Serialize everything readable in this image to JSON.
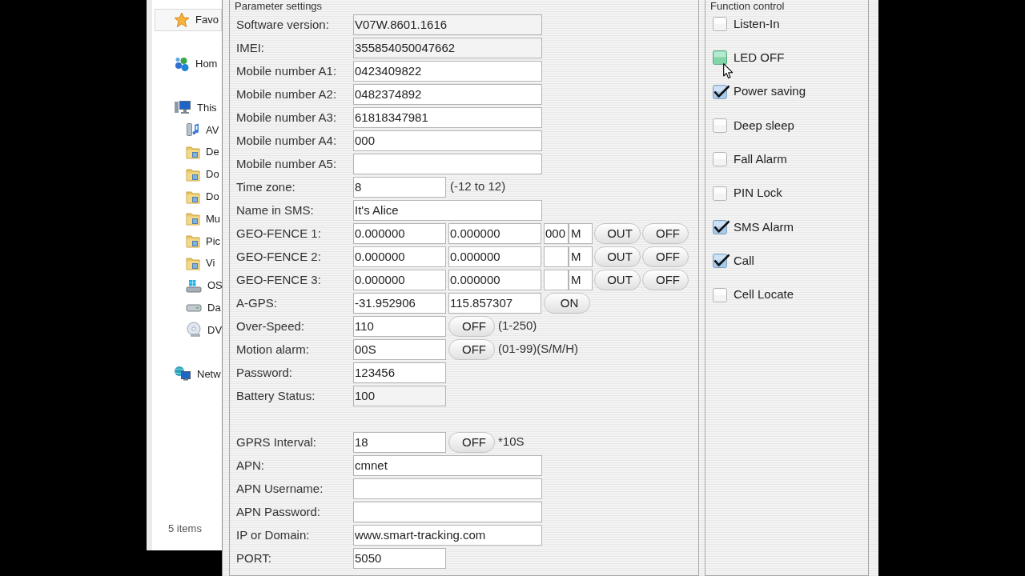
{
  "explorer": {
    "nav": [
      {
        "label": "Favo",
        "kind": "favorites",
        "selected": true
      },
      {
        "label": "Hom",
        "kind": "homegroup",
        "selected": false
      },
      {
        "label": "This",
        "kind": "computer",
        "selected": false,
        "children": [
          {
            "label": "AV",
            "kind": "device",
            "selected": false
          },
          {
            "label": "De",
            "kind": "folder",
            "selected": false
          },
          {
            "label": "Do",
            "kind": "folder",
            "selected": false
          },
          {
            "label": "Do",
            "kind": "folder",
            "selected": false
          },
          {
            "label": "Mu",
            "kind": "folder",
            "selected": false
          },
          {
            "label": "Pic",
            "kind": "folder",
            "selected": false
          },
          {
            "label": "Vi",
            "kind": "folder",
            "selected": false
          },
          {
            "label": "OS",
            "kind": "system_drive",
            "selected": false
          },
          {
            "label": "Da",
            "kind": "drive",
            "selected": false
          },
          {
            "label": "DV",
            "kind": "disc_drive",
            "selected": false
          }
        ]
      },
      {
        "label": "Netw",
        "kind": "network",
        "selected": false
      }
    ],
    "status": "5 items"
  },
  "parameters": {
    "title": "Parameter settings",
    "sections": [
      {
        "rows": [
          {
            "label": "Software version:",
            "parts": [
              {
                "kind": "long_field",
                "value": "V07W.8601.1616",
                "readonly": true
              }
            ]
          },
          {
            "label": "IMEI:",
            "parts": [
              {
                "kind": "long_field",
                "value": "355854050047662",
                "readonly": true
              }
            ]
          },
          {
            "label": "Mobile number A1:",
            "parts": [
              {
                "kind": "long_field",
                "value": "0423409822",
                "readonly": false
              }
            ]
          },
          {
            "label": "Mobile number A2:",
            "parts": [
              {
                "kind": "long_field",
                "value": "0482374892",
                "readonly": false
              }
            ]
          },
          {
            "label": "Mobile number A3:",
            "parts": [
              {
                "kind": "long_field",
                "value": "61818347981",
                "readonly": false
              }
            ]
          },
          {
            "label": "Mobile number A4:",
            "parts": [
              {
                "kind": "long_field",
                "value": "000",
                "readonly": false
              }
            ]
          },
          {
            "label": "Mobile number A5:",
            "parts": [
              {
                "kind": "long_field",
                "readonly": false
              }
            ]
          },
          {
            "label": "Time zone:",
            "parts": [
              {
                "kind": "short_field",
                "value": "8",
                "readonly": false
              },
              {
                "kind": "note",
                "text": "(-12 to 12)"
              }
            ]
          },
          {
            "label": "Name in SMS:",
            "parts": [
              {
                "kind": "long_field",
                "value": "It's Alice",
                "readonly": false
              }
            ]
          },
          {
            "label": "GEO-FENCE 1:",
            "parts": [
              {
                "kind": "short_field",
                "value": "0.000000",
                "readonly": false
              },
              {
                "kind": "short_field",
                "value": "0.000000",
                "readonly": false
              },
              {
                "kind": "tiny_field",
                "value": "000",
                "readonly": false
              },
              {
                "kind": "unit",
                "text": "M"
              },
              {
                "kind": "button",
                "text": "OUT"
              },
              {
                "kind": "button",
                "text": "OFF"
              }
            ]
          },
          {
            "label": "GEO-FENCE 2:",
            "parts": [
              {
                "kind": "short_field",
                "value": "0.000000",
                "readonly": false
              },
              {
                "kind": "short_field",
                "value": "0.000000",
                "readonly": false
              },
              {
                "kind": "tiny_field",
                "readonly": false
              },
              {
                "kind": "unit",
                "text": "M"
              },
              {
                "kind": "button",
                "text": "OUT"
              },
              {
                "kind": "button",
                "text": "OFF"
              }
            ]
          },
          {
            "label": "GEO-FENCE 3:",
            "parts": [
              {
                "kind": "short_field",
                "value": "0.000000",
                "readonly": false
              },
              {
                "kind": "short_field",
                "value": "0.000000",
                "readonly": false
              },
              {
                "kind": "tiny_field",
                "readonly": false
              },
              {
                "kind": "unit",
                "text": "M"
              },
              {
                "kind": "button",
                "text": "OUT"
              },
              {
                "kind": "button",
                "text": "OFF"
              }
            ]
          },
          {
            "label": "A-GPS:",
            "parts": [
              {
                "kind": "short_field",
                "value": "-31.952906",
                "readonly": false
              },
              {
                "kind": "short_field",
                "value": "115.857307",
                "readonly": false
              },
              {
                "kind": "button",
                "text": "ON"
              }
            ]
          },
          {
            "label": "Over-Speed:",
            "parts": [
              {
                "kind": "short_field",
                "value": "110",
                "readonly": false
              },
              {
                "kind": "button",
                "text": "OFF"
              },
              {
                "kind": "note",
                "text": "(1-250)"
              }
            ]
          },
          {
            "label": "Motion alarm:",
            "parts": [
              {
                "kind": "short_field",
                "value": "00S",
                "readonly": false
              },
              {
                "kind": "button",
                "text": "OFF"
              },
              {
                "kind": "note",
                "text": "(01-99)(S/M/H)"
              }
            ]
          },
          {
            "label": "Password:",
            "parts": [
              {
                "kind": "short_field",
                "value": "123456",
                "readonly": false
              }
            ]
          },
          {
            "label": "Battery Status:",
            "parts": [
              {
                "kind": "short_field",
                "value": "100",
                "readonly": true
              }
            ]
          }
        ]
      },
      {
        "rows": [
          {
            "label": "GPRS Interval:",
            "parts": [
              {
                "kind": "short_field",
                "value": "18",
                "readonly": false
              },
              {
                "kind": "button",
                "text": "OFF"
              },
              {
                "kind": "note",
                "text": "*10S"
              }
            ]
          },
          {
            "label": "APN:",
            "parts": [
              {
                "kind": "long_field",
                "value": "cmnet",
                "readonly": false
              }
            ]
          },
          {
            "label": "APN Username:",
            "parts": [
              {
                "kind": "long_field",
                "readonly": false
              }
            ]
          },
          {
            "label": "APN Password:",
            "parts": [
              {
                "kind": "long_field",
                "readonly": false
              }
            ]
          },
          {
            "label": "IP or Domain:",
            "parts": [
              {
                "kind": "long_field",
                "value": "www.smart-tracking.com",
                "readonly": false
              }
            ]
          },
          {
            "label": "PORT:",
            "parts": [
              {
                "kind": "short_field",
                "value": "5050",
                "readonly": false
              }
            ]
          }
        ]
      }
    ]
  },
  "function_control": {
    "title": "Function control",
    "items": [
      {
        "label": "Listen-In",
        "checked": false,
        "hovered": false
      },
      {
        "label": "LED OFF",
        "checked": false,
        "hovered": true
      },
      {
        "label": "Power saving",
        "checked": true,
        "hovered": false
      },
      {
        "label": "Deep sleep",
        "checked": false,
        "hovered": false
      },
      {
        "label": "Fall Alarm",
        "checked": false,
        "hovered": false
      },
      {
        "label": "PIN Lock",
        "checked": false,
        "hovered": false
      },
      {
        "label": "SMS Alarm",
        "checked": true,
        "hovered": false
      },
      {
        "label": "Call",
        "checked": true,
        "hovered": false
      },
      {
        "label": "Cell Locate",
        "checked": false,
        "hovered": false
      }
    ]
  }
}
